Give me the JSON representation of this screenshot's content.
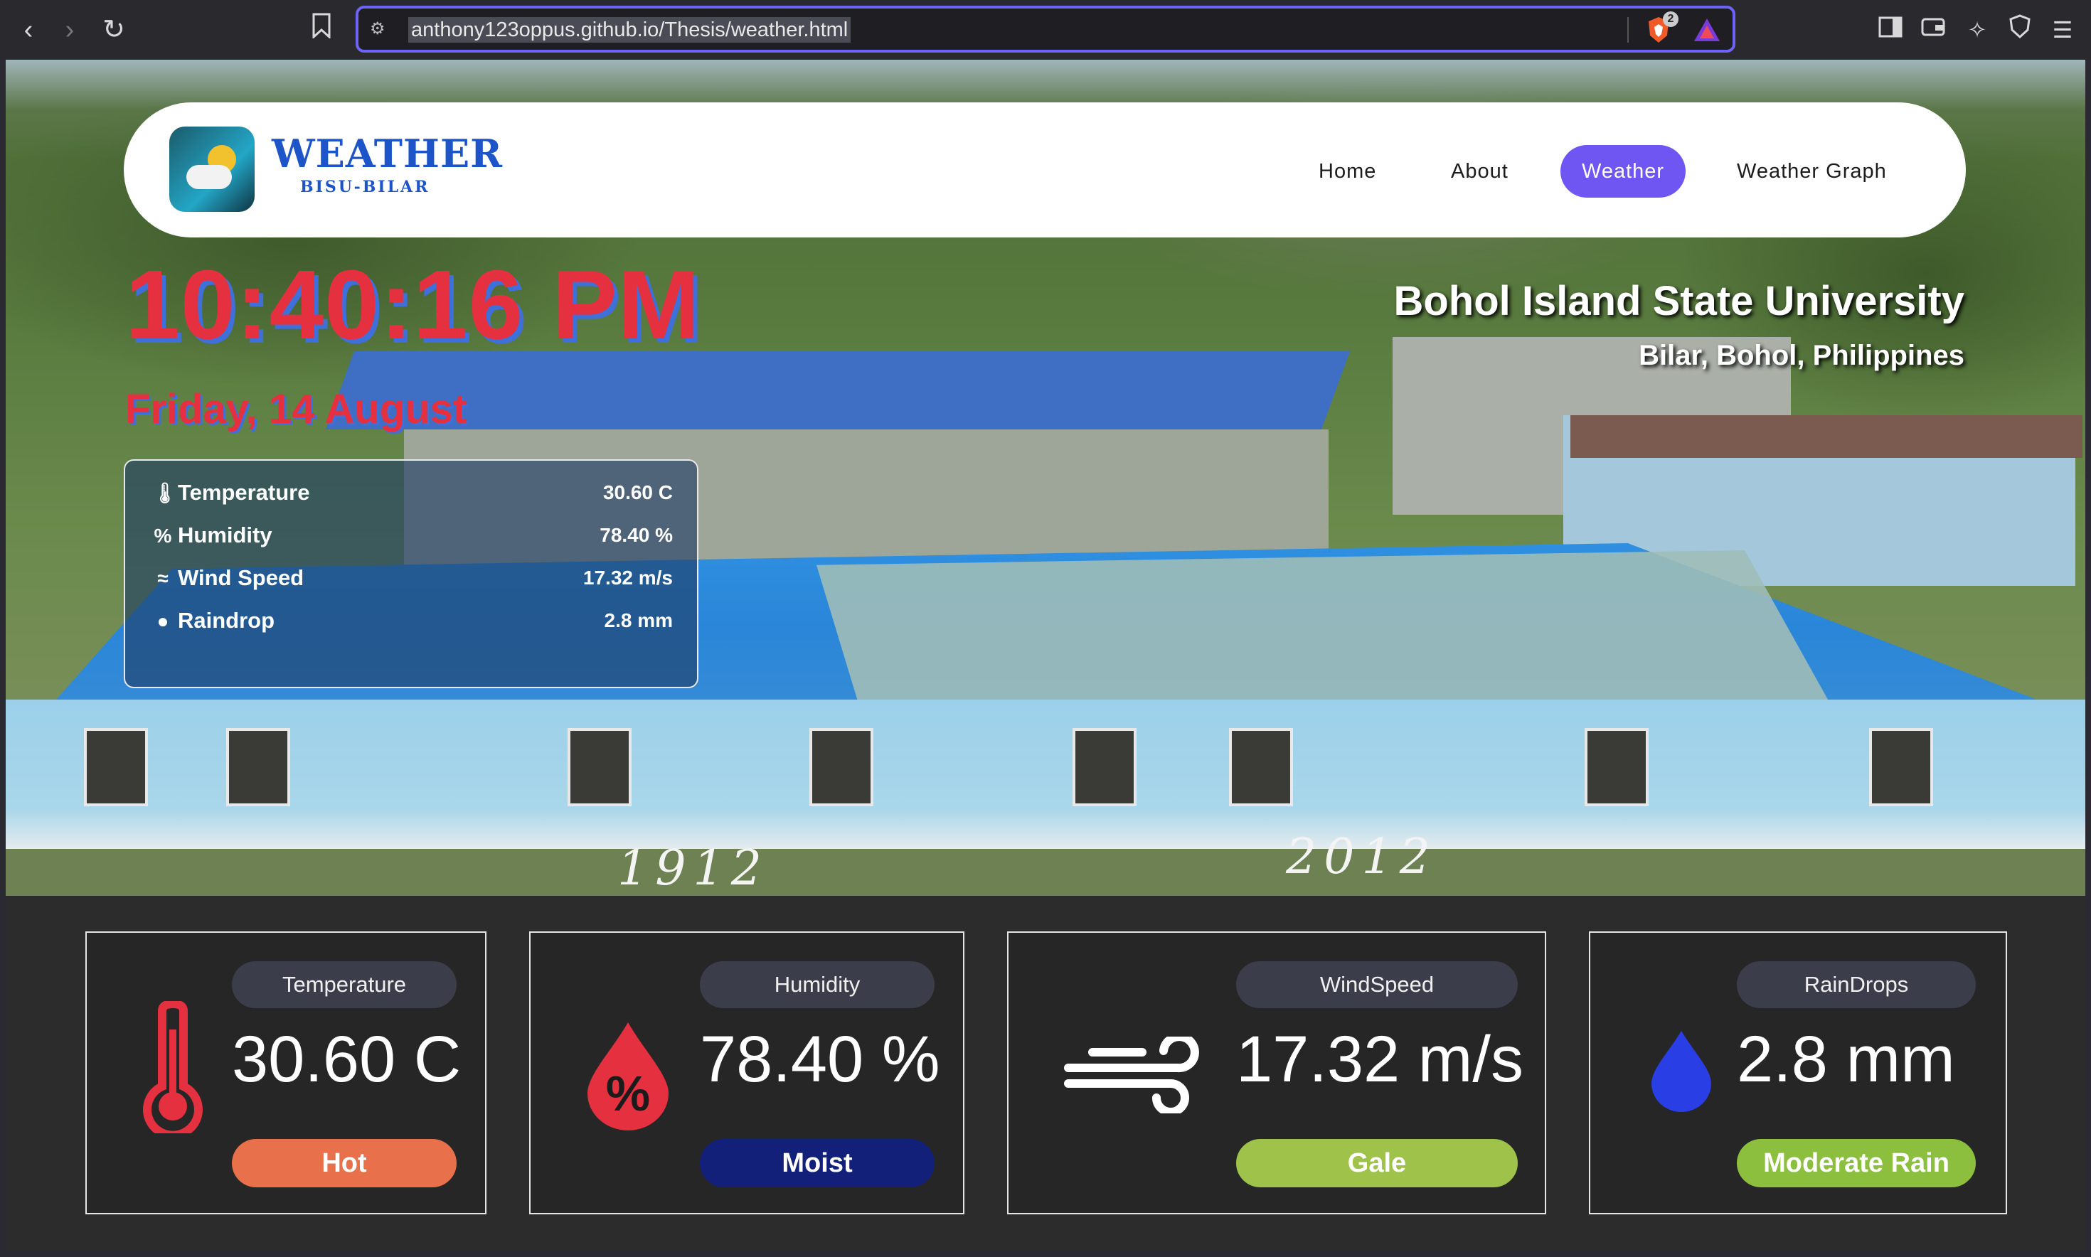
{
  "browser": {
    "url": "anthony123oppus.github.io/Thesis/weather.html",
    "brave_badge": "2",
    "accent": "#6d63f7"
  },
  "logo": {
    "title": "WEATHER",
    "subtitle": "BISU-BILAR"
  },
  "nav": {
    "items": [
      {
        "label": "Home"
      },
      {
        "label": "About"
      },
      {
        "label": "Weather",
        "active": true
      },
      {
        "label": "Weather Graph"
      }
    ],
    "active_color": "#6f55f2"
  },
  "clock": {
    "time": "10:40:16 PM",
    "date": "Friday, 14 August"
  },
  "university": {
    "name": "Bohol Island State University",
    "location": "Bilar, Bohol, Philippines"
  },
  "hero": {
    "years": [
      "1912",
      "2012"
    ]
  },
  "summary": [
    {
      "icon": "thermometer-icon",
      "label": "Temperature",
      "value": "30.60 C"
    },
    {
      "icon": "humidity-icon",
      "label": "Humidity",
      "value": "78.40 %"
    },
    {
      "icon": "wind-icon",
      "label": "Wind Speed",
      "value": "17.32 m/s"
    },
    {
      "icon": "raindrop-icon",
      "label": "Raindrop",
      "value": "2.8 mm"
    }
  ],
  "cards": [
    {
      "title": "Temperature",
      "value": "30.60 C",
      "status": "Hot",
      "status_color": "#e8704a",
      "icon": "thermometer-icon",
      "icon_color": "#e53040"
    },
    {
      "title": "Humidity",
      "value": "78.40 %",
      "status": "Moist",
      "status_color": "#13207a",
      "icon": "humidity-icon",
      "icon_color": "#e53040"
    },
    {
      "title": "WindSpeed",
      "value": "17.32 m/s",
      "status": "Gale",
      "status_color": "#9fc34a",
      "icon": "wind-icon",
      "icon_color": "#ffffff"
    },
    {
      "title": "RainDrops",
      "value": "2.8 mm",
      "status": "Moderate Rain",
      "status_color": "#8dbf3e",
      "icon": "raindrop-icon",
      "icon_color": "#2a3ee6"
    }
  ]
}
